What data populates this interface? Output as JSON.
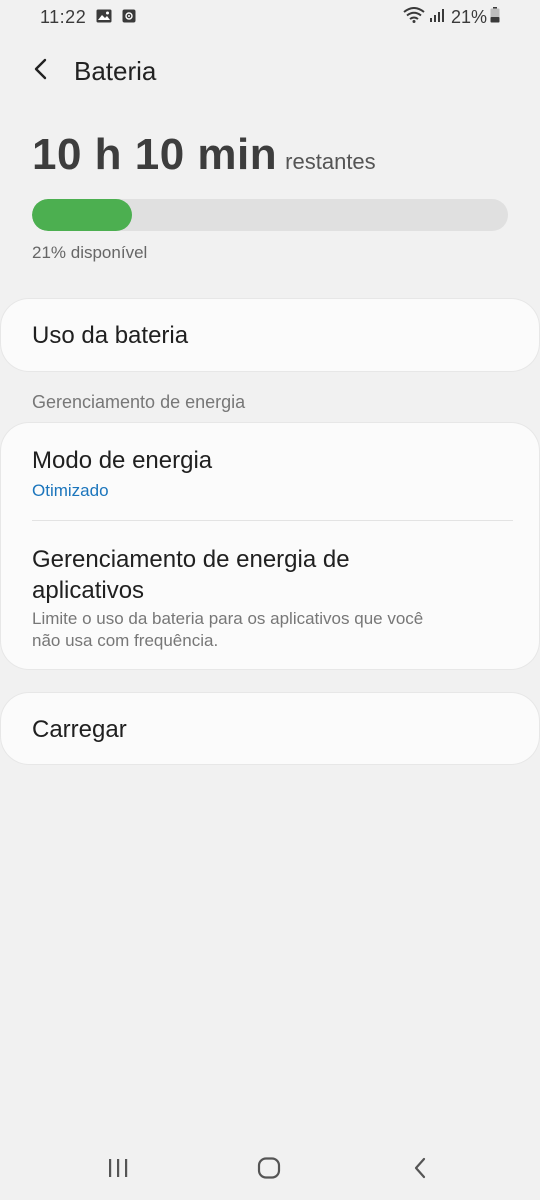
{
  "status_bar": {
    "time": "11:22",
    "left_icons": [
      "image-icon",
      "screen-record-icon"
    ],
    "right_icons": [
      "wifi-icon",
      "signal-icon"
    ],
    "battery_text": "21%",
    "battery_level": 0.21
  },
  "app_bar": {
    "back_icon": "chevron-left-icon",
    "title": "Bateria"
  },
  "summary": {
    "time_remaining": "10 h 10 min",
    "time_suffix": "restantes",
    "battery_percent": 21,
    "progress_color": "#4caf50",
    "available_text": "21% disponível"
  },
  "battery_usage": {
    "label": "Uso da bateria"
  },
  "power_management": {
    "section_title": "Gerenciamento de energia",
    "power_mode": {
      "title": "Modo de energia",
      "value": "Otimizado"
    },
    "app_power": {
      "title_line1": "Gerenciamento de energia de",
      "title_line2": "aplicativos",
      "subtitle_line1": "Limite o uso da bateria para os aplicativos que você",
      "subtitle_line2": "não usa com frequência."
    }
  },
  "charging": {
    "label": "Carregar"
  },
  "nav_bar": {
    "buttons": [
      "recents-icon",
      "home-icon",
      "back-icon"
    ]
  },
  "colors": {
    "accent": "#1b75bc",
    "background": "#f1f1f1",
    "card": "#fbfbfb"
  }
}
